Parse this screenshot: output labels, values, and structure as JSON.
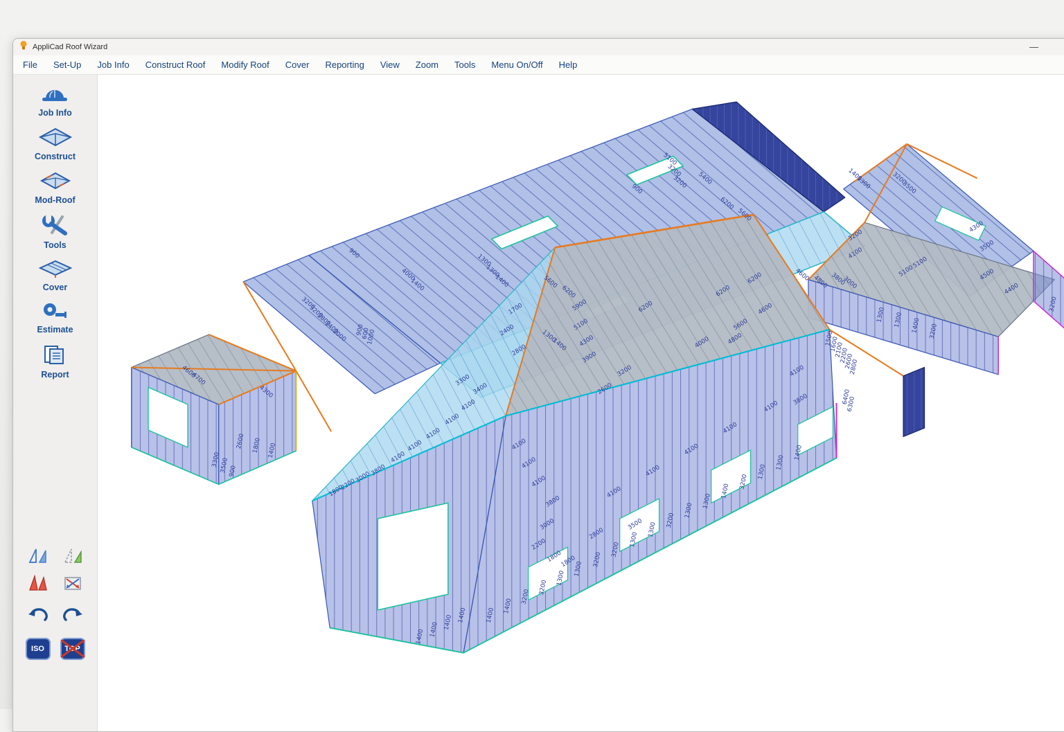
{
  "window": {
    "title": "AppliCad Roof Wizard",
    "controls": {
      "minimize": "—",
      "maximize": "□"
    }
  },
  "menu": {
    "items": [
      "File",
      "Set-Up",
      "Job Info",
      "Construct Roof",
      "Modify Roof",
      "Cover",
      "Reporting",
      "View",
      "Zoom",
      "Tools",
      "Menu On/Off",
      "Help"
    ]
  },
  "sidebar": {
    "items": [
      {
        "label": "Job Info",
        "icon": "hard-hat-icon"
      },
      {
        "label": "Construct",
        "icon": "roof-construct-icon"
      },
      {
        "label": "Mod-Roof",
        "icon": "roof-modify-icon"
      },
      {
        "label": "Tools",
        "icon": "wrench-icon"
      },
      {
        "label": "Cover",
        "icon": "roof-cover-icon"
      },
      {
        "label": "Estimate",
        "icon": "tape-measure-icon"
      },
      {
        "label": "Report",
        "icon": "report-icon"
      }
    ],
    "quick_tools": [
      {
        "icon": "triangle-pair-blue-icon"
      },
      {
        "icon": "triangle-area-green-icon"
      },
      {
        "icon": "triangle-pair-red-icon"
      },
      {
        "icon": "crossed-arrows-icon"
      },
      {
        "icon": "undo-icon"
      },
      {
        "icon": "redo-icon"
      }
    ],
    "view_buttons": [
      {
        "label": "ISO"
      },
      {
        "label": "TOP"
      }
    ]
  },
  "canvas": {
    "background": "#ffffff",
    "colors": {
      "hip_ridge_orange": "#e87a1e",
      "eave_cyan": "#00bcd4",
      "edge_blue": "#3a57b5",
      "wall_panel_blue": "#7d8ed6",
      "roof_gray": "#b2bac4",
      "roof_light_blue": "#aad8f0",
      "dark_wall_navy": "#243494",
      "accent_magenta": "#c92fd4",
      "accent_green": "#18c29a",
      "corner_yellow": "#d4b400"
    },
    "dimension_labels": [
      [
        "900",
        363,
        252,
        40
      ],
      [
        "4000",
        440,
        282,
        40
      ],
      [
        "1400",
        453,
        296,
        40
      ],
      [
        "1300",
        548,
        262,
        40
      ],
      [
        "1300",
        560,
        277,
        40
      ],
      [
        "1400",
        573,
        291,
        40
      ],
      [
        "5600",
        642,
        292,
        40
      ],
      [
        "6200",
        668,
        306,
        40
      ],
      [
        "900",
        765,
        162,
        40
      ],
      [
        "5100",
        812,
        120,
        40
      ],
      [
        "3200",
        818,
        136,
        40
      ],
      [
        "3200",
        826,
        152,
        40
      ],
      [
        "5400",
        862,
        147,
        40
      ],
      [
        "6200",
        893,
        182,
        40
      ],
      [
        "5600",
        918,
        198,
        40
      ],
      [
        "3200",
        298,
        322,
        40
      ],
      [
        "3200",
        309,
        334,
        40
      ],
      [
        "2800",
        320,
        345,
        40
      ],
      [
        "2400",
        331,
        356,
        40
      ],
      [
        "2000",
        342,
        367,
        40
      ],
      [
        "5900",
        686,
        325,
        -32
      ],
      [
        "5100",
        688,
        352,
        -32
      ],
      [
        "4300",
        696,
        375,
        -32
      ],
      [
        "3900",
        700,
        398,
        -32
      ],
      [
        "1300",
        640,
        368,
        40
      ],
      [
        "1400",
        655,
        380,
        40
      ],
      [
        "4600",
        1000,
        282,
        40
      ],
      [
        "4800",
        1026,
        292,
        40
      ],
      [
        "3800",
        1051,
        288,
        40
      ],
      [
        "3000",
        1068,
        293,
        40
      ],
      [
        "1700",
        595,
        330,
        -32
      ],
      [
        "2400",
        583,
        360,
        -32
      ],
      [
        "2800",
        600,
        388,
        -32
      ],
      [
        "3300",
        520,
        430,
        -32
      ],
      [
        "3400",
        545,
        442,
        -32
      ],
      [
        "4100",
        528,
        465,
        -32
      ],
      [
        "4100",
        505,
        485,
        -32
      ],
      [
        "4100",
        478,
        505,
        -32
      ],
      [
        "4100",
        452,
        522,
        -32
      ],
      [
        "4100",
        428,
        538,
        -32
      ],
      [
        "3800",
        400,
        556,
        -32
      ],
      [
        "3000",
        378,
        566,
        -32
      ],
      [
        "2200",
        357,
        576,
        -32
      ],
      [
        "1800",
        340,
        585,
        -32
      ],
      [
        "4100",
        600,
        520,
        -32
      ],
      [
        "4100",
        614,
        546,
        -32
      ],
      [
        "4100",
        628,
        572,
        -32
      ],
      [
        "3800",
        648,
        600,
        -32
      ],
      [
        "3000",
        640,
        632,
        -32
      ],
      [
        "2200",
        628,
        660,
        -32
      ],
      [
        "1800",
        670,
        684,
        -32
      ],
      [
        "6200",
        780,
        327,
        -32
      ],
      [
        "6200",
        890,
        305,
        -32
      ],
      [
        "6200",
        935,
        287,
        -32
      ],
      [
        "5600",
        915,
        352,
        -32
      ],
      [
        "4600",
        950,
        330,
        -32
      ],
      [
        "4800",
        907,
        372,
        -32
      ],
      [
        "4000",
        860,
        377,
        -32
      ],
      [
        "3200",
        750,
        417,
        -32
      ],
      [
        "2600",
        722,
        442,
        -32
      ],
      [
        "4100",
        995,
        417,
        -32
      ],
      [
        "3800",
        1000,
        457,
        -32
      ],
      [
        "4100",
        958,
        467,
        -32
      ],
      [
        "4100",
        900,
        497,
        -32
      ],
      [
        "4100",
        845,
        527,
        -32
      ],
      [
        "4100",
        790,
        557,
        -32
      ],
      [
        "4100",
        735,
        587,
        -32
      ],
      [
        "3500",
        765,
        632,
        -32
      ],
      [
        "2800",
        710,
        645,
        -32
      ],
      [
        "1800",
        650,
        677,
        -32
      ],
      [
        "1500",
        1042,
        370,
        -78
      ],
      [
        "1600",
        1049,
        378,
        -78
      ],
      [
        "2100",
        1056,
        386,
        -78
      ],
      [
        "2200",
        1063,
        394,
        -78
      ],
      [
        "2600",
        1070,
        402,
        -78
      ],
      [
        "2800",
        1077,
        410,
        -78
      ],
      [
        "6400",
        1066,
        452,
        -78
      ],
      [
        "6300",
        1073,
        462,
        -78
      ],
      [
        "1400",
        560,
        758,
        -78
      ],
      [
        "1400",
        585,
        745,
        -78
      ],
      [
        "3200",
        610,
        732,
        -78
      ],
      [
        "3200",
        635,
        719,
        -78
      ],
      [
        "1300",
        660,
        706,
        -78
      ],
      [
        "1300",
        685,
        693,
        -78
      ],
      [
        "3200",
        712,
        680,
        -78
      ],
      [
        "3200",
        738,
        666,
        -78
      ],
      [
        "1300",
        764,
        652,
        -78
      ],
      [
        "1300",
        790,
        638,
        -78
      ],
      [
        "3200",
        816,
        625,
        -78
      ],
      [
        "1300",
        842,
        611,
        -78
      ],
      [
        "1300",
        868,
        598,
        -78
      ],
      [
        "1400",
        894,
        584,
        -78
      ],
      [
        "3200",
        920,
        571,
        -78
      ],
      [
        "1300",
        946,
        557,
        -78
      ],
      [
        "1300",
        972,
        544,
        -78
      ],
      [
        "1400",
        998,
        530,
        -78
      ],
      [
        "1400",
        460,
        788,
        -78
      ],
      [
        "1400",
        480,
        778,
        -78
      ],
      [
        "1400",
        500,
        768,
        -78
      ],
      [
        "1400",
        520,
        758,
        -78
      ],
      [
        "4600",
        128,
        418,
        40
      ],
      [
        "4700",
        142,
        428,
        40
      ],
      [
        "4300",
        238,
        446,
        40
      ],
      [
        "2600",
        205,
        514,
        -78
      ],
      [
        "1800",
        228,
        520,
        -78
      ],
      [
        "1400",
        250,
        527,
        -78
      ],
      [
        "3300",
        170,
        540,
        -78
      ],
      [
        "3500",
        182,
        548,
        -78
      ],
      [
        "900",
        194,
        556,
        -78
      ],
      [
        "900",
        375,
        358,
        -78
      ],
      [
        "600",
        383,
        363,
        -78
      ],
      [
        "1000",
        391,
        368,
        -78
      ],
      [
        "3200",
        1138,
        147,
        40
      ],
      [
        "3500",
        1152,
        160,
        40
      ],
      [
        "1400",
        1075,
        142,
        40
      ],
      [
        "1300",
        1087,
        153,
        40
      ],
      [
        "4100",
        1078,
        252,
        -32
      ],
      [
        "3200",
        1078,
        227,
        -32
      ],
      [
        "5100",
        1150,
        277,
        -32
      ],
      [
        "5100",
        1170,
        265,
        -32
      ],
      [
        "4300",
        1250,
        215,
        -32
      ],
      [
        "3500",
        1265,
        242,
        -32
      ],
      [
        "4500",
        1265,
        282,
        -32
      ],
      [
        "4400",
        1300,
        302,
        -32
      ],
      [
        "3200",
        1360,
        322,
        -78
      ],
      [
        "1300",
        1115,
        337,
        -78
      ],
      [
        "1300",
        1140,
        344,
        -78
      ],
      [
        "1400",
        1165,
        352,
        -78
      ],
      [
        "3200",
        1190,
        360,
        -78
      ]
    ]
  }
}
